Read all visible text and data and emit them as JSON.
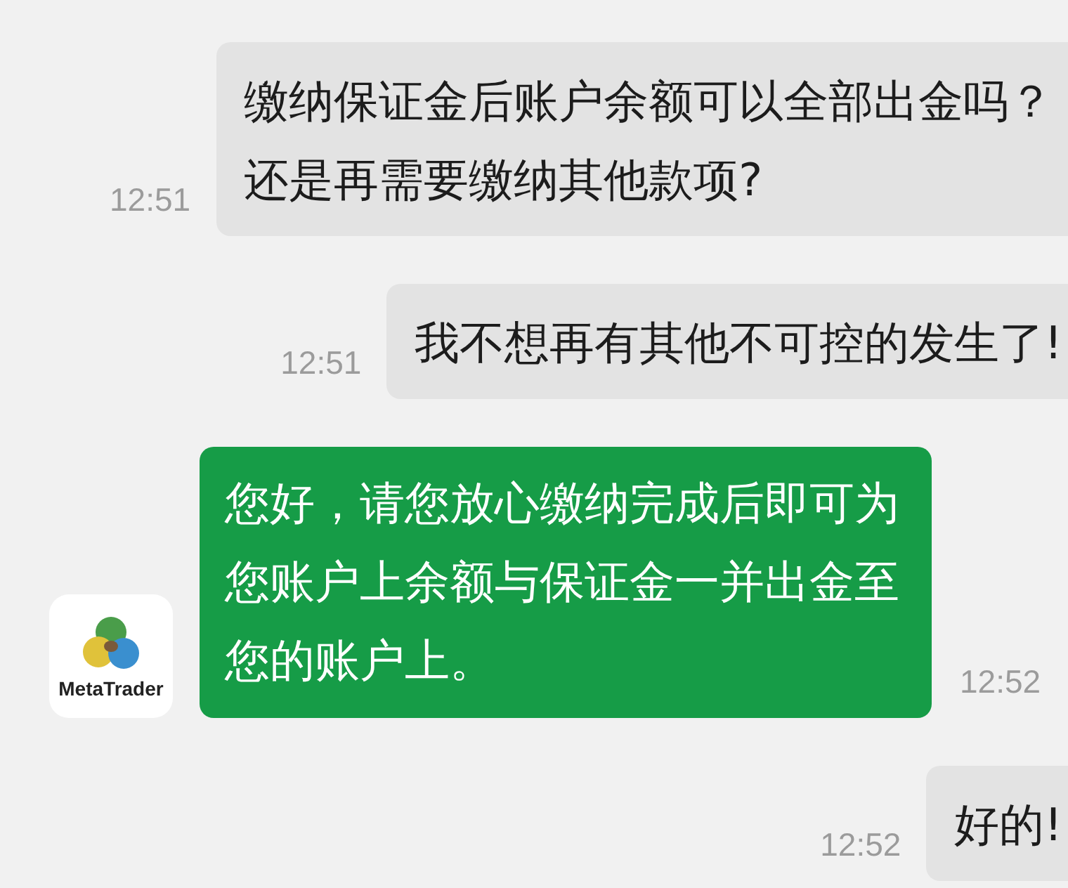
{
  "messages": [
    {
      "kind": "sent",
      "text": "缴纳保证金后账户余额可以全部出金吗？还是再需要缴纳其他款项?",
      "time": "12:51"
    },
    {
      "kind": "sent",
      "text": "我不想再有其他不可控的发生了!",
      "time": "12:51"
    },
    {
      "kind": "received",
      "sender": "MetaTrader",
      "text": "您好，请您放心缴纳完成后即可为您账户上余额与保证金一并出金至您的账户上。",
      "time": "12:52"
    },
    {
      "kind": "sent",
      "text": "好的!",
      "time": "12:52"
    }
  ]
}
